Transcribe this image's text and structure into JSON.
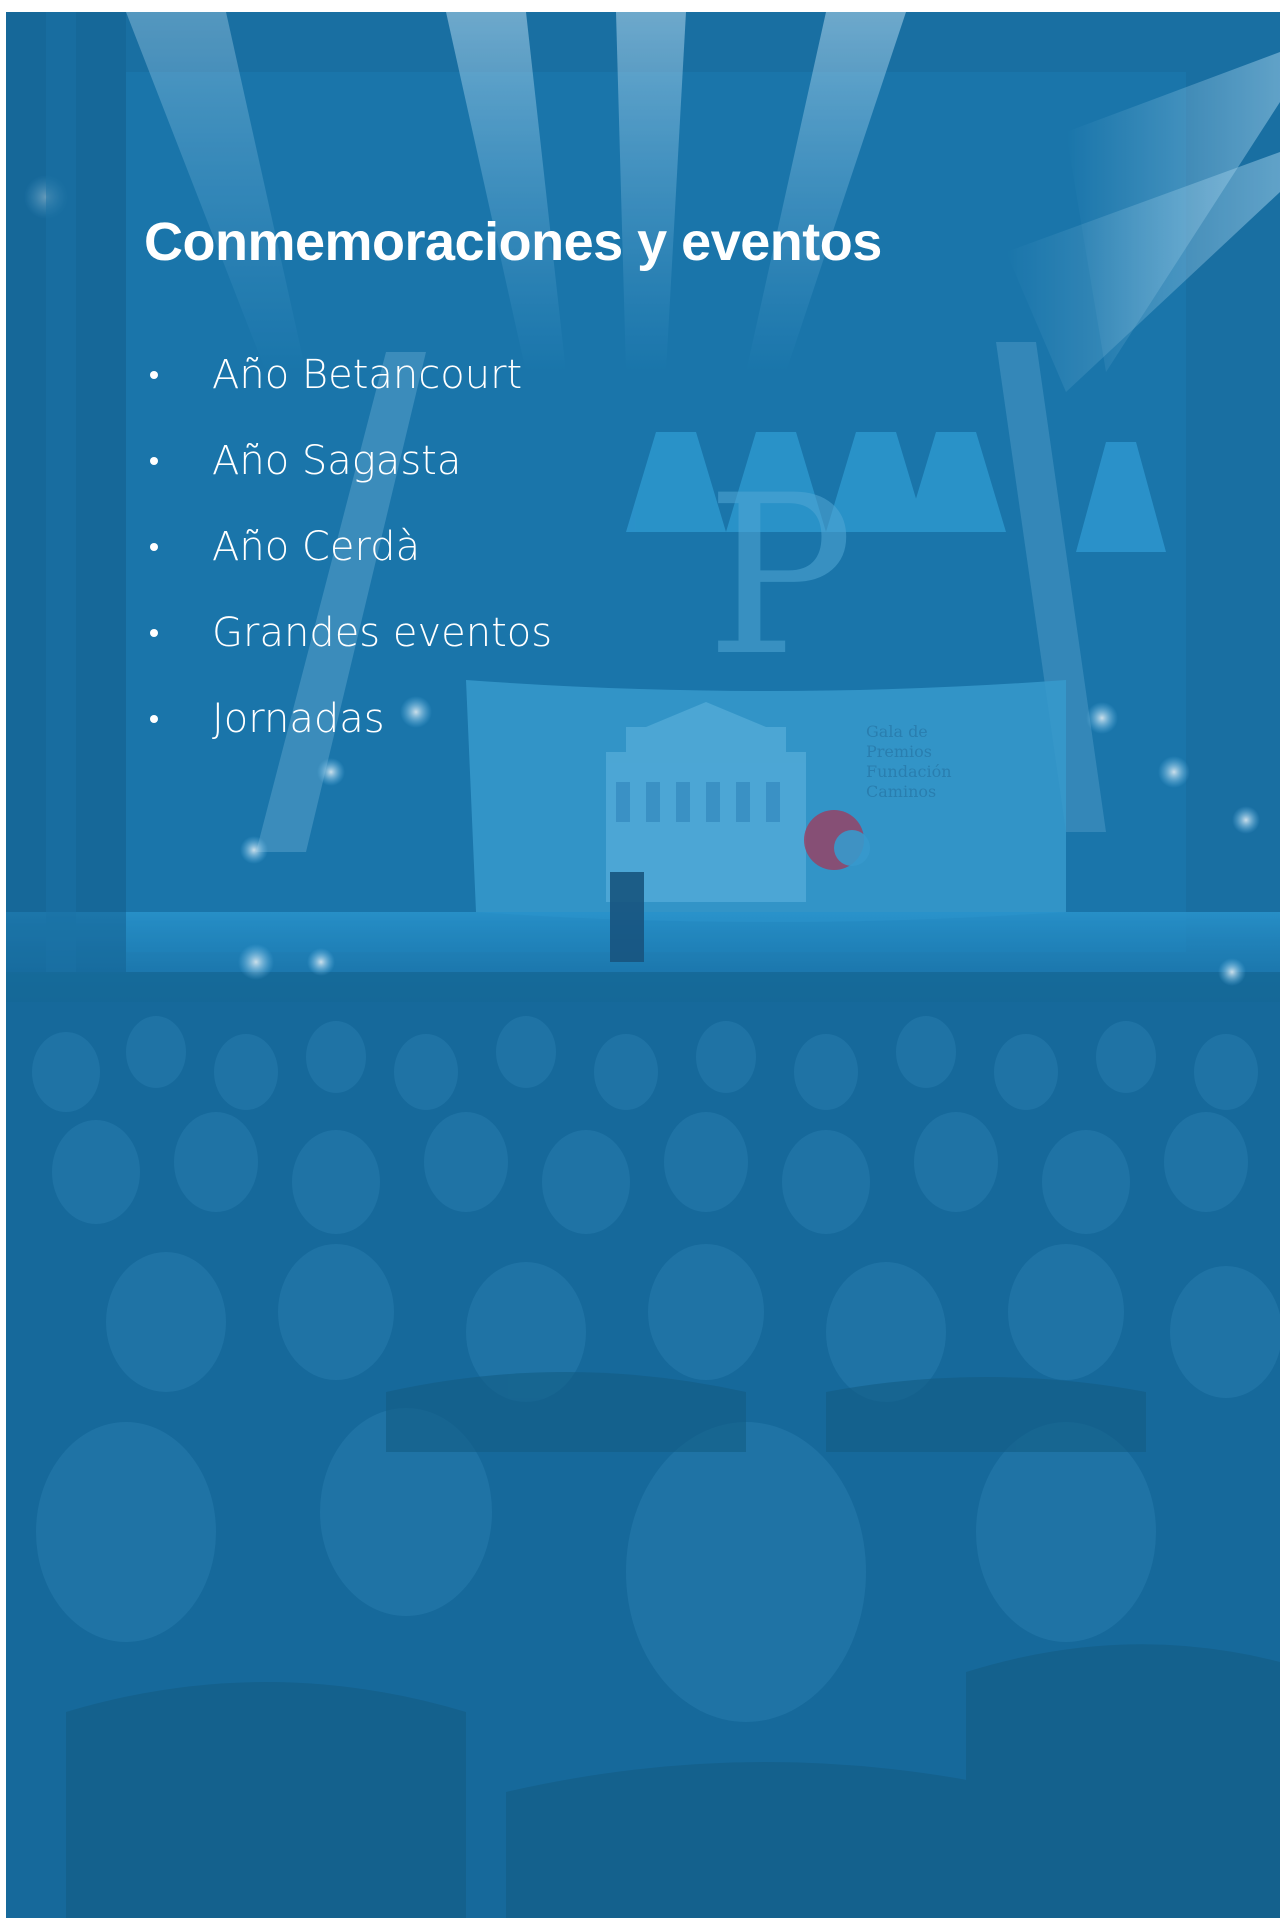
{
  "section": {
    "title": "Conmemoraciones y eventos"
  },
  "menu": {
    "items": [
      {
        "label": "Año Betancourt"
      },
      {
        "label": "Año Sagasta"
      },
      {
        "label": "Año Cerdà"
      },
      {
        "label": "Grandes eventos"
      },
      {
        "label": "Jornadas"
      }
    ]
  },
  "background": {
    "tint_color": "#1e78aa",
    "stage_logo_letter": "P",
    "screen_text": "Gala de Premios Fundación Caminos"
  }
}
